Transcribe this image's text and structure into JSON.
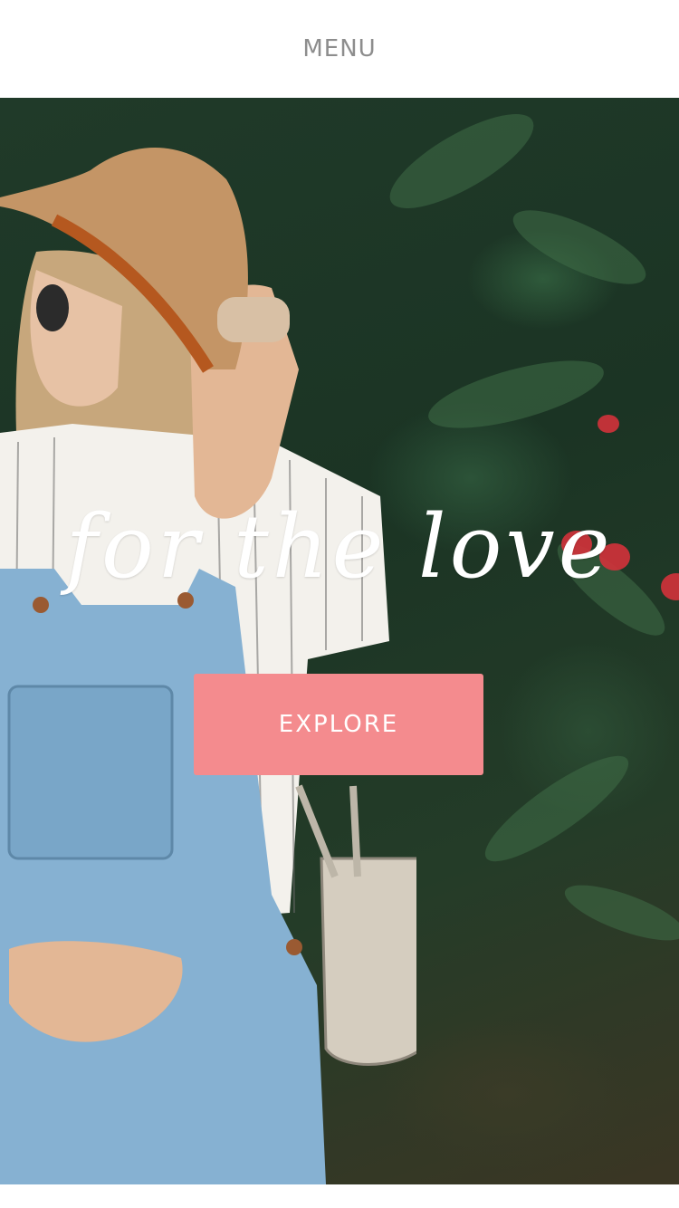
{
  "header": {
    "menu_label": "MENU"
  },
  "hero": {
    "tagline": "for the love",
    "cta_label": "EXPLORE",
    "image_icon": "photo-icon"
  },
  "colors": {
    "cta_background": "#f48b8e",
    "menu_text": "#8d8d8d",
    "header_background": "#ffffff"
  }
}
